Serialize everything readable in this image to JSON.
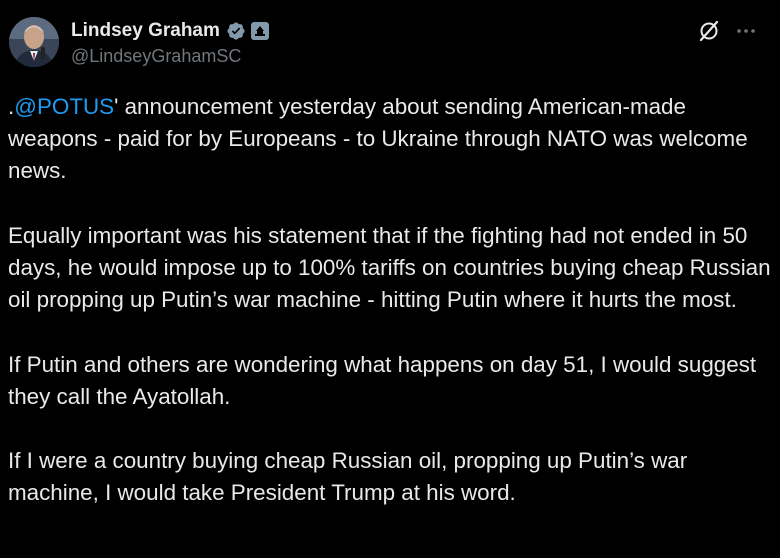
{
  "author": {
    "display_name": "Lindsey Graham",
    "handle": "@LindseyGrahamSC",
    "verified_badge_icon": "verified-badge-icon",
    "affiliation_badge_icon": "government-badge-icon"
  },
  "actions": {
    "grok_icon": "grok-icon",
    "more_icon": "more-icon"
  },
  "post": {
    "paragraphs": [
      {
        "prefix": ".",
        "mention": "@POTUS",
        "text": "' announcement yesterday about sending American-made weapons  - paid for by Europeans - to Ukraine through NATO was welcome news."
      },
      {
        "text": "Equally important was his statement that if the fighting had not ended in 50 days, he would impose up to 100% tariffs on countries buying cheap Russian oil propping up Putin’s war machine - hitting Putin where it hurts the most."
      },
      {
        "text": "If Putin and others are wondering what happens on day 51, I would suggest they call the Ayatollah."
      },
      {
        "text": "If I were a country buying cheap Russian oil, propping up Putin’s war machine, I would take President Trump at his word."
      }
    ]
  },
  "colors": {
    "background": "#000000",
    "text_primary": "#e7e9ea",
    "text_secondary": "#71767b",
    "link": "#1d9bf0",
    "verified_badge": "#829aab"
  }
}
